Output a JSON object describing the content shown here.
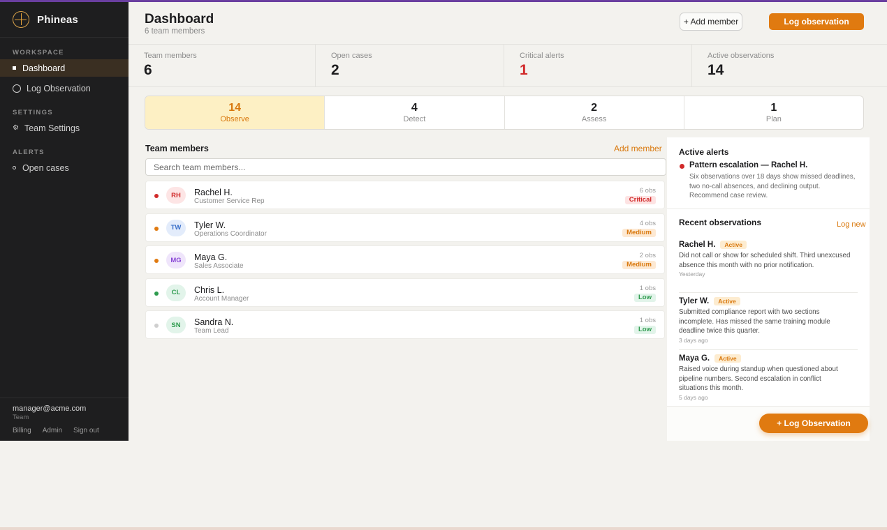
{
  "sidebar": {
    "brand": "Phineas",
    "sections": [
      "WORKSPACE",
      "SETTINGS",
      "ALERTS"
    ],
    "items": [
      {
        "label": "Dashboard"
      },
      {
        "label": "Log Observation"
      },
      {
        "label": "Team Settings"
      },
      {
        "label": "Open cases"
      }
    ],
    "footer": {
      "email": "manager@acme.com",
      "role": "Team",
      "links": [
        "Billing",
        "Admin",
        "Sign out"
      ]
    }
  },
  "header": {
    "title": "Dashboard",
    "subtitle": "6 team members",
    "add_member_label": "+ Add member",
    "log_observation_label": "Log observation"
  },
  "stats": [
    {
      "label": "Team members",
      "value": "6"
    },
    {
      "label": "Open cases",
      "value": "2"
    },
    {
      "label": "Critical alerts",
      "value": "1"
    },
    {
      "label": "Active observations",
      "value": "14"
    }
  ],
  "stages": [
    {
      "count": "14",
      "label": "Observe"
    },
    {
      "count": "4",
      "label": "Detect"
    },
    {
      "count": "2",
      "label": "Assess"
    },
    {
      "count": "1",
      "label": "Plan"
    }
  ],
  "team": {
    "title": "Team members",
    "add_label": "Add member",
    "search_placeholder": "Search team members...",
    "members": [
      {
        "initials": "RH",
        "name": "Rachel H.",
        "role": "Customer Service Rep",
        "obs": "6 obs",
        "level": "Critical"
      },
      {
        "initials": "TW",
        "name": "Tyler W.",
        "role": "Operations Coordinator",
        "obs": "4 obs",
        "level": "Medium"
      },
      {
        "initials": "MG",
        "name": "Maya G.",
        "role": "Sales Associate",
        "obs": "2 obs",
        "level": "Medium"
      },
      {
        "initials": "CL",
        "name": "Chris L.",
        "role": "Account Manager",
        "obs": "1 obs",
        "level": "Low"
      },
      {
        "initials": "SN",
        "name": "Sandra N.",
        "role": "Team Lead",
        "obs": "1 obs",
        "level": "Low"
      }
    ]
  },
  "alerts": {
    "title": "Active alerts",
    "headline": "Pattern escalation — Rachel H.",
    "body": "Six observations over 18 days show missed deadlines, two no-call absences, and declining output. Recommend case review."
  },
  "recent": {
    "title": "Recent observations",
    "log_new_label": "Log new",
    "items": [
      {
        "name": "Rachel H.",
        "tag": "Active",
        "text": "Did not call or show for scheduled shift. Third unexcused absence this month with no prior notification.",
        "time": "Yesterday"
      },
      {
        "name": "Tyler W.",
        "tag": "Active",
        "text": "Submitted compliance report with two sections incomplete. Has missed the same training module deadline twice this quarter.",
        "time": "3 days ago"
      },
      {
        "name": "Maya G.",
        "tag": "Active",
        "text": "Raised voice during standup when questioned about pipeline numbers. Second escalation in conflict situations this month.",
        "time": "5 days ago"
      }
    ]
  },
  "fab_label": "+ Log Observation",
  "colors": {
    "accent": "#e07a10",
    "critical": "#d12a2a",
    "medium": "#d9780d",
    "low": "#2e9b4e",
    "sidebar_bg": "#1e1e1f"
  }
}
